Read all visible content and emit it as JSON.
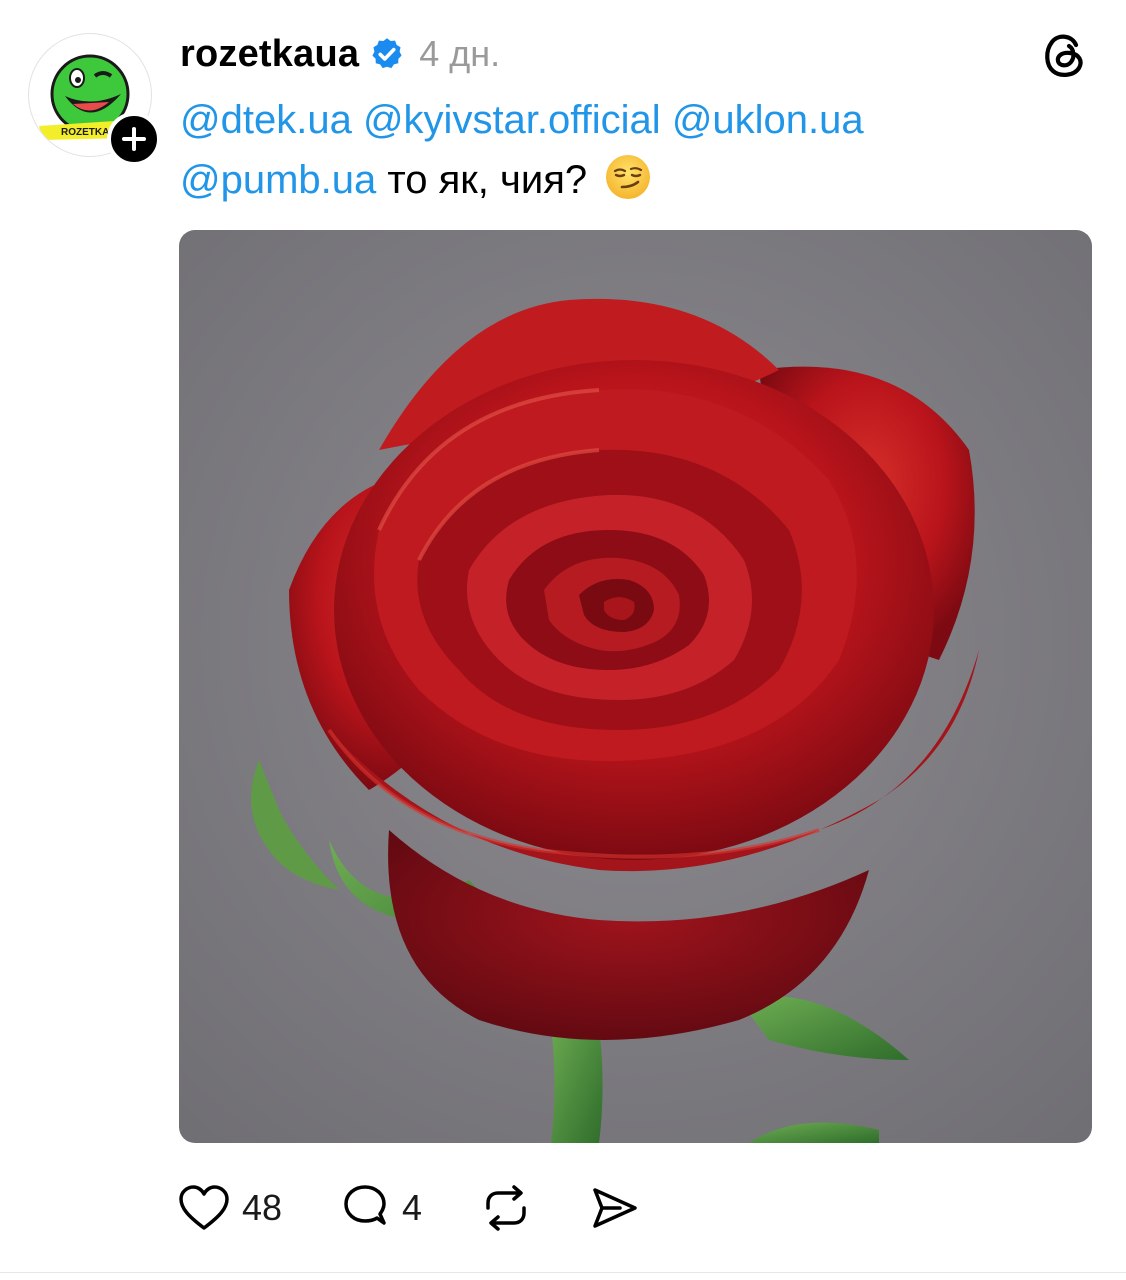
{
  "post": {
    "username": "rozetkaua",
    "time": "4 дн.",
    "avatar_text": "ROZETKA",
    "text": {
      "mention1": "@dtek.ua",
      "mention2": "@kyivstar.official",
      "mention3": "@uklon.ua",
      "mention4": "@pumb.ua",
      "body": " то як, чия?"
    },
    "emoji": "smirk-face",
    "image": "red-rose",
    "likes": "48",
    "comments": "4"
  },
  "colors": {
    "mention": "#2196e8",
    "verified": "#1a8cf0",
    "muted": "#9a9a9a",
    "avatar_green": "#3ec83b",
    "avatar_yellow": "#f3ee2a"
  },
  "icons": [
    "verified-badge-icon",
    "threads-logo-icon",
    "plus-icon",
    "heart-icon",
    "comment-icon",
    "repost-icon",
    "share-icon"
  ]
}
